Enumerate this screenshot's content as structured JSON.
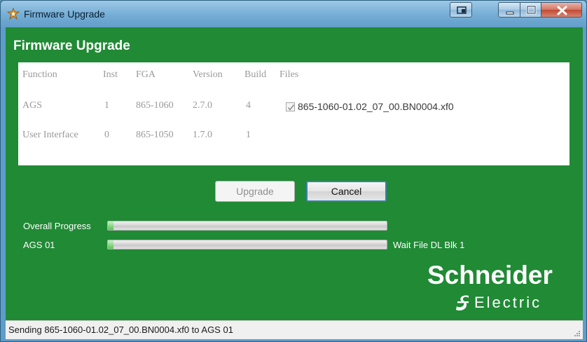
{
  "window": {
    "title": "Firmware Upgrade"
  },
  "page": {
    "heading": "Firmware Upgrade"
  },
  "table": {
    "columns": [
      "Function",
      "Inst",
      "FGA",
      "Version",
      "Build",
      "Files"
    ],
    "rows": [
      {
        "function": "AGS",
        "inst": "1",
        "fga": "865-1060",
        "version": "2.7.0",
        "build": "4",
        "file": "865-1060-01.02_07_00.BN0004.xf0",
        "file_checked": true
      },
      {
        "function": "User Interface",
        "inst": "0",
        "fga": "865-1050",
        "version": "1.7.0",
        "build": "1",
        "file": "",
        "file_checked": false
      }
    ]
  },
  "buttons": {
    "upgrade": "Upgrade",
    "cancel": "Cancel"
  },
  "progress": {
    "overall": {
      "label": "Overall Progress",
      "fraction": 0.02
    },
    "device": {
      "label": "AGS 01",
      "fraction": 0.02,
      "status": "Wait File DL Blk 1"
    }
  },
  "logo": {
    "name": "Schneider",
    "sub": "Electric"
  },
  "status_bar": {
    "text": "Sending 865-1060-01.02_07_00.BN0004.xf0 to AGS 01"
  },
  "colors": {
    "client_bg": "#208a35",
    "progress_fill": "#5cc058"
  },
  "icons": {
    "app": "firmware-app-icon",
    "dock": "dock-icon",
    "minimize": "minimize-icon",
    "maximize": "maximize-icon",
    "close": "close-icon"
  }
}
